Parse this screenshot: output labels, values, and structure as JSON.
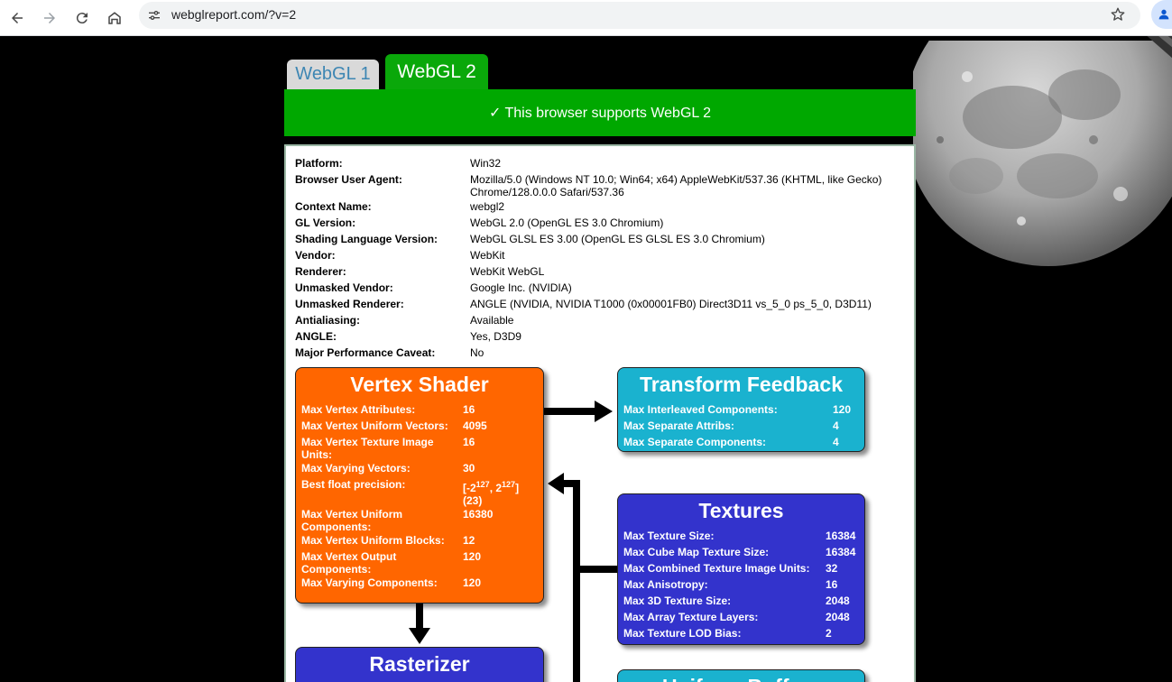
{
  "browser": {
    "url": "webglreport.com/?v=2",
    "icons": [
      "back-icon",
      "forward-icon",
      "reload-icon",
      "home-icon",
      "site-info-icon",
      "bookmark-star-icon",
      "profile-icon"
    ]
  },
  "tabs": [
    {
      "label": "WebGL 1",
      "active": false
    },
    {
      "label": "WebGL 2",
      "active": true
    }
  ],
  "banner": "✓ This browser supports WebGL 2",
  "info": [
    {
      "key": "Platform:",
      "value": "Win32"
    },
    {
      "key": "Browser User Agent:",
      "value": "Mozilla/5.0 (Windows NT 10.0; Win64; x64) AppleWebKit/537.36 (KHTML, like Gecko) Chrome/128.0.0.0 Safari/537.36"
    },
    {
      "key": "Context Name:",
      "value": "webgl2"
    },
    {
      "key": "GL Version:",
      "value": "WebGL 2.0 (OpenGL ES 3.0 Chromium)"
    },
    {
      "key": "Shading Language Version:",
      "value": "WebGL GLSL ES 3.00 (OpenGL ES GLSL ES 3.0 Chromium)"
    },
    {
      "key": "Vendor:",
      "value": "WebKit"
    },
    {
      "key": "Renderer:",
      "value": "WebKit WebGL"
    },
    {
      "key": "Unmasked Vendor:",
      "value": "Google Inc. (NVIDIA)"
    },
    {
      "key": "Unmasked Renderer:",
      "value": "ANGLE (NVIDIA, NVIDIA T1000 (0x00001FB0) Direct3D11 vs_5_0 ps_5_0, D3D11)"
    },
    {
      "key": "Antialiasing:",
      "value": "Available"
    },
    {
      "key": "ANGLE:",
      "value": "Yes, D3D9"
    },
    {
      "key": "Major Performance Caveat:",
      "value": "No"
    }
  ],
  "vertex": {
    "title": "Vertex Shader",
    "rows": [
      {
        "key": "Max Vertex Attributes:",
        "value": "16"
      },
      {
        "key": "Max Vertex Uniform Vectors:",
        "value": "4095"
      },
      {
        "key": "Max Vertex Texture Image Units:",
        "value": "16"
      },
      {
        "key": "Max Varying Vectors:",
        "value": "30"
      }
    ],
    "precision_key": "Best float precision:",
    "precision": {
      "open": "[-2",
      "exp1": "127",
      "mid": ", 2",
      "exp2": "127",
      "close": "]",
      "bits": "(23)"
    },
    "rows2": [
      {
        "key": "Max Vertex Uniform Components:",
        "value": "16380"
      },
      {
        "key": "Max Vertex Uniform Blocks:",
        "value": "12"
      },
      {
        "key": "Max Vertex Output Components:",
        "value": "120"
      },
      {
        "key": "Max Varying Components:",
        "value": "120"
      }
    ]
  },
  "transform_feedback": {
    "title": "Transform Feedback",
    "rows": [
      {
        "key": "Max Interleaved Components:",
        "value": "120"
      },
      {
        "key": "Max Separate Attribs:",
        "value": "4"
      },
      {
        "key": "Max Separate Components:",
        "value": "4"
      }
    ]
  },
  "textures": {
    "title": "Textures",
    "rows": [
      {
        "key": "Max Texture Size:",
        "value": "16384"
      },
      {
        "key": "Max Cube Map Texture Size:",
        "value": "16384"
      },
      {
        "key": "Max Combined Texture Image Units:",
        "value": "32"
      },
      {
        "key": "Max Anisotropy:",
        "value": "16"
      },
      {
        "key": "Max 3D Texture Size:",
        "value": "2048"
      },
      {
        "key": "Max Array Texture Layers:",
        "value": "2048"
      },
      {
        "key": "Max Texture LOD Bias:",
        "value": "2"
      }
    ]
  },
  "rasterizer": {
    "title": "Rasterizer"
  },
  "uniform_buffers": {
    "title": "Uniform Buffers"
  },
  "colors": {
    "vertex": "#ff6600",
    "transform_feedback": "#1ab2cf",
    "textures": "#3333cc",
    "banner": "#00a800"
  }
}
